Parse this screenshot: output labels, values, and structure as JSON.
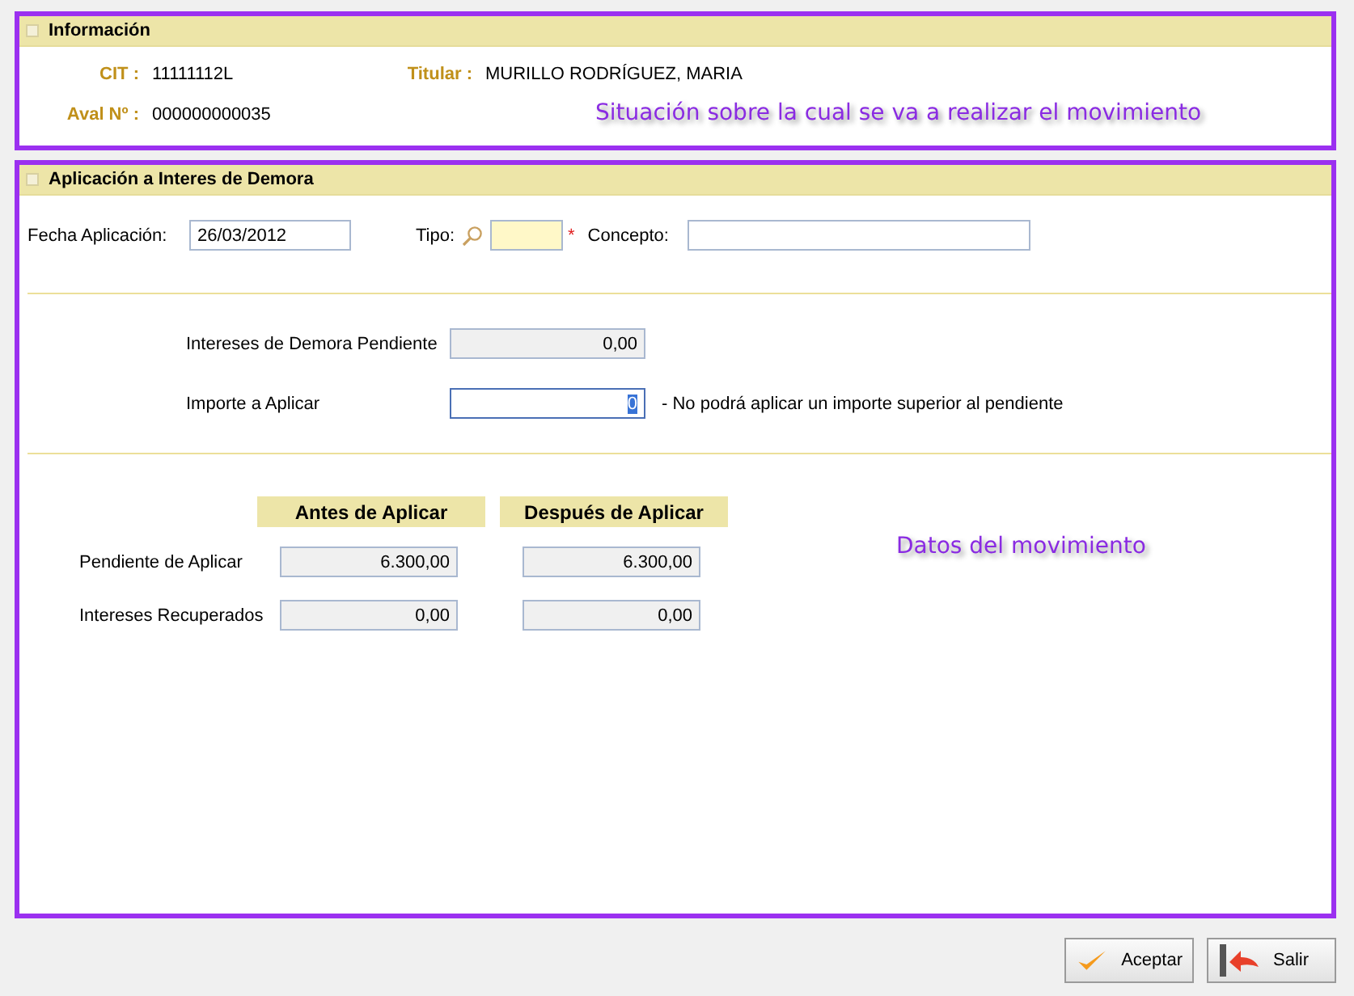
{
  "info_panel": {
    "title": "Información",
    "fields": [
      {
        "label": "CIT :",
        "value": "11111112L"
      },
      {
        "label": "Titular :",
        "value": "MURILLO RODRÍGUEZ, MARIA"
      },
      {
        "label": "Aval Nº :",
        "value": "000000000035"
      }
    ],
    "annotation": "Situación sobre la cual se va a realizar el movimiento"
  },
  "application_panel": {
    "title": "Aplicación a Interes de Demora",
    "fecha": {
      "label": "Fecha Aplicación:",
      "value": "26/03/2012"
    },
    "tipo": {
      "label": "Tipo:",
      "required_mark": "*"
    },
    "concepto": {
      "label": "Concepto:"
    },
    "pending": {
      "label": "Intereses de Demora Pendiente",
      "value": "0,00"
    },
    "amount": {
      "label": "Importe a Aplicar",
      "value": "0",
      "note": "- No podrá aplicar un importe superior al pendiente"
    },
    "columns": [
      "Antes de Aplicar",
      "Después de Aplicar"
    ],
    "rows": [
      {
        "label": "Pendiente de Aplicar",
        "values": [
          "6.300,00",
          "6.300,00"
        ]
      },
      {
        "label": "Intereses Recuperados",
        "values": [
          "0,00",
          "0,00"
        ]
      }
    ],
    "annotation": "Datos del movimiento"
  },
  "buttons": [
    {
      "kind": "accept",
      "label": "Aceptar"
    },
    {
      "kind": "exit",
      "label": "Salir"
    }
  ]
}
